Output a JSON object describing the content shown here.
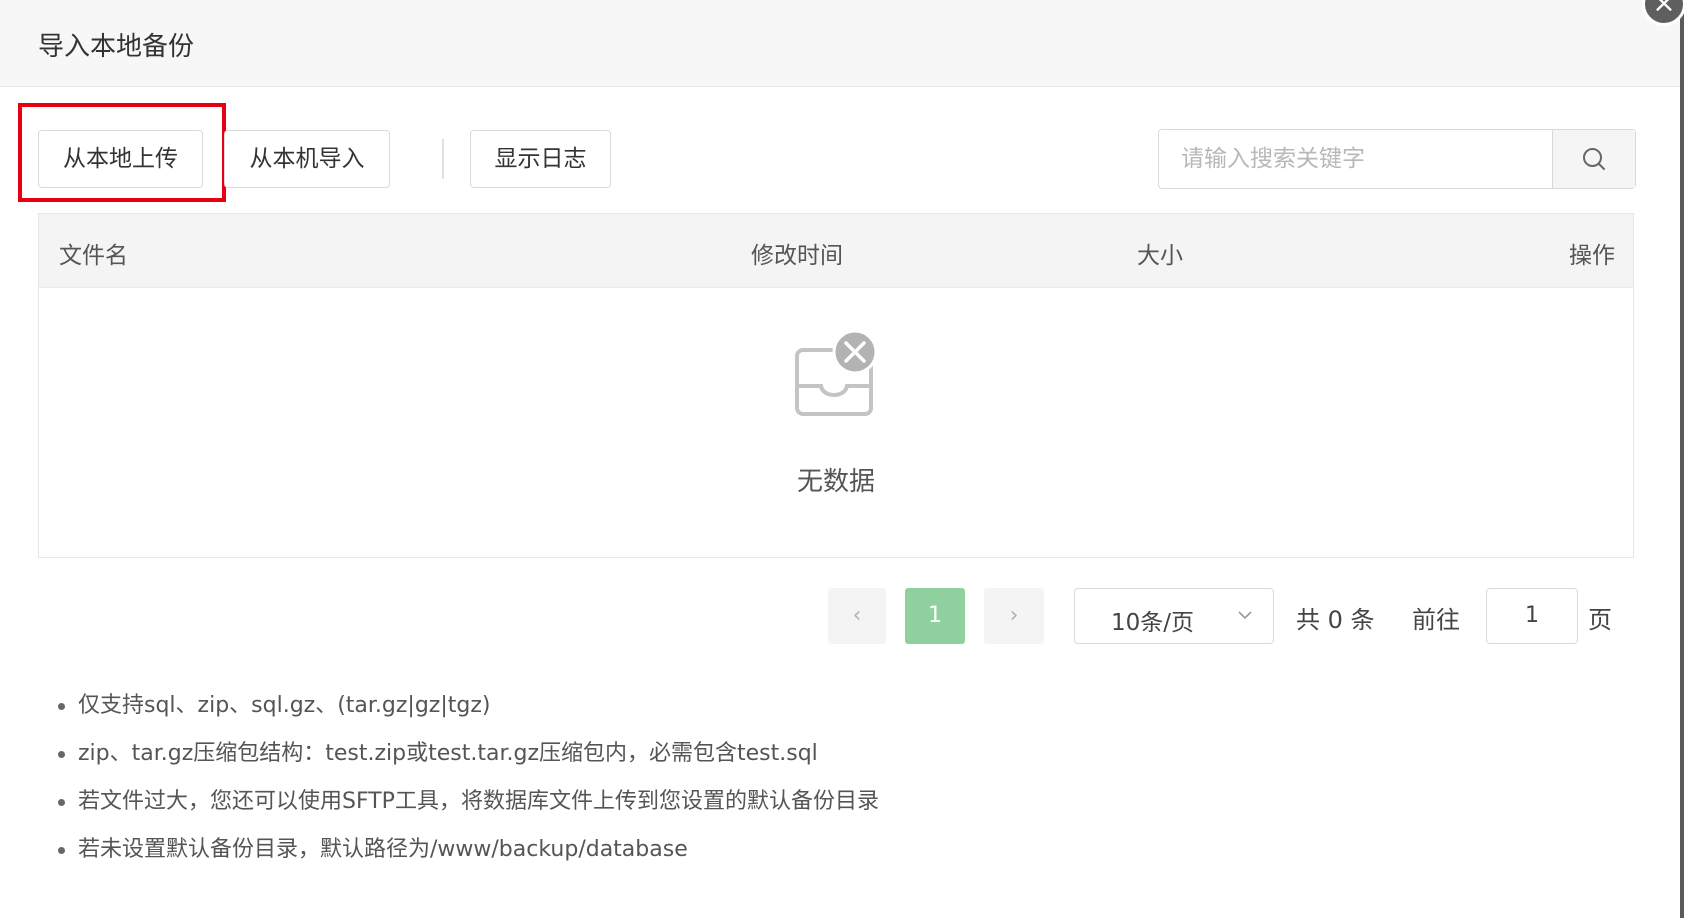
{
  "dialog": {
    "title": "导入本地备份",
    "close_glyph": "×"
  },
  "toolbar": {
    "upload_local_label": "从本地上传",
    "import_machine_label": "从本机导入",
    "show_log_label": "显示日志"
  },
  "search": {
    "placeholder": "请输入搜索关键字",
    "icon": "search-icon"
  },
  "table": {
    "columns": [
      "文件名",
      "修改时间",
      "大小",
      "操作"
    ],
    "rows": [],
    "empty_text": "无数据",
    "empty_icon": "empty-inbox-icon"
  },
  "pagination": {
    "prev_glyph": "‹",
    "next_glyph": "›",
    "current_page": "1",
    "page_size_label": "10条/页",
    "total_text": "共 0 条",
    "goto_label": "前往",
    "goto_value": "1",
    "page_suffix": "页"
  },
  "tips": [
    "仅支持sql、zip、sql.gz、(tar.gz|gz|tgz)",
    "zip、tar.gz压缩包结构：test.zip或test.tar.gz压缩包内，必需包含test.sql",
    "若文件过大，您还可以使用SFTP工具，将数据库文件上传到您设置的默认备份目录",
    "若未设置默认备份目录，默认路径为/www/backup/database"
  ],
  "colors": {
    "accent_green": "#8fd19e",
    "highlight_red": "#e60012"
  }
}
